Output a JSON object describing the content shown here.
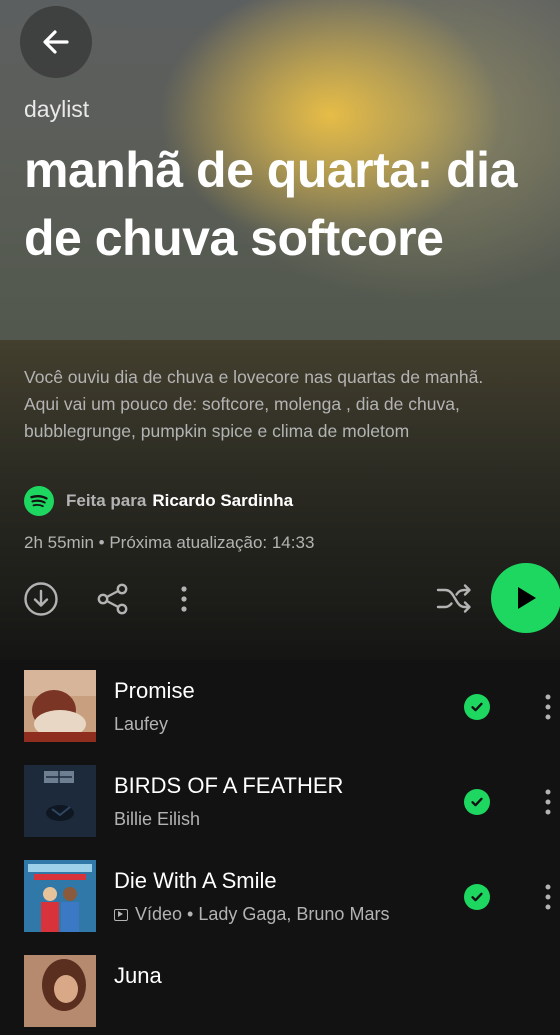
{
  "header": {
    "back_label": "Back",
    "kicker": "daylist",
    "title": "manhã de quarta: dia de chuva softcore",
    "description": "Você ouviu dia de chuva e lovecore nas quartas de manhã. Aqui vai um pouco de: softcore, molenga , dia de chuva, bubblegrunge, pumpkin spice e clima de moletom",
    "made_for_prefix": "Feita para",
    "made_for_name": "Ricardo Sardinha",
    "meta": "2h 55min • Próxima atualização: 14:33"
  },
  "actions": {
    "download_icon": "download-icon",
    "share_icon": "share-icon",
    "more_icon": "more-vertical-icon",
    "shuffle_icon": "shuffle-icon",
    "play_icon": "play-icon"
  },
  "tracks": [
    {
      "title": "Promise",
      "subtitle": "Laufey",
      "downloaded": true
    },
    {
      "title": "BIRDS OF A FEATHER",
      "subtitle": "Billie Eilish",
      "downloaded": true
    },
    {
      "title": "Die With A Smile",
      "subtitle": "Vídeo • Lady Gaga, Bruno Mars",
      "is_video": true,
      "downloaded": true
    },
    {
      "title": "Juna",
      "subtitle": "",
      "downloaded": false
    }
  ],
  "colors": {
    "accent": "#1ed760",
    "background": "#121212",
    "secondary_text": "#b3b3b3"
  }
}
